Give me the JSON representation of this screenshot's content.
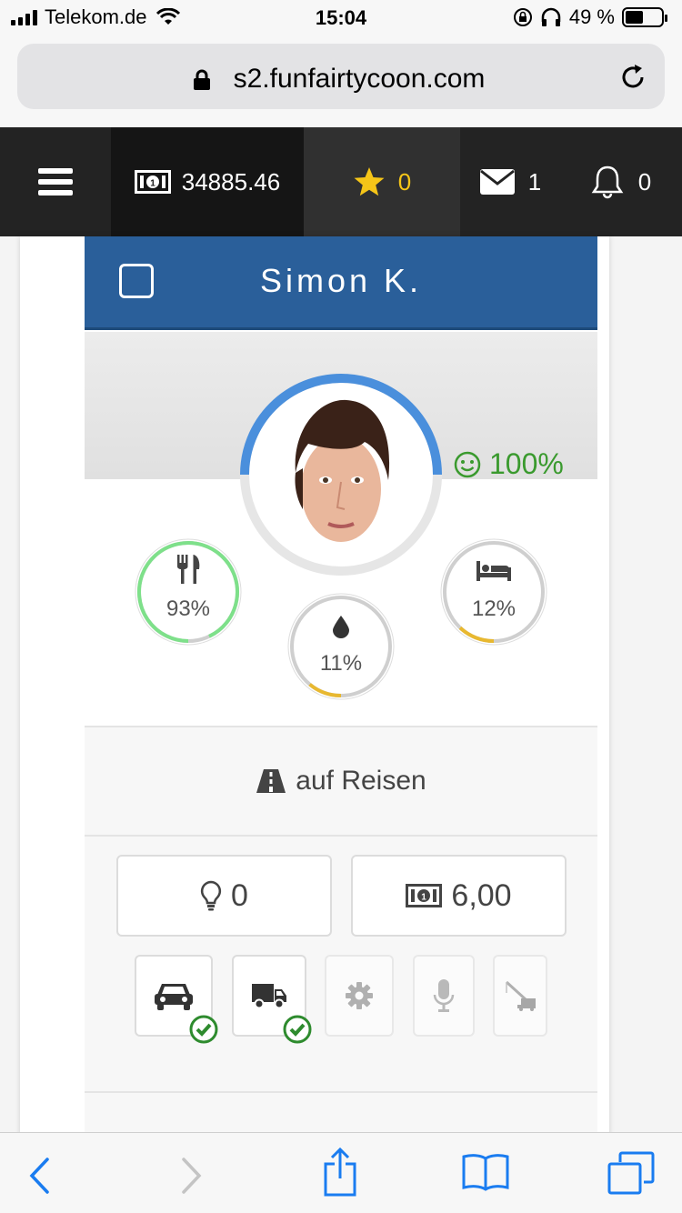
{
  "statusbar": {
    "carrier": "Telekom.de",
    "time": "15:04",
    "battery_percent": "49 %",
    "battery_level": 0.49
  },
  "browser": {
    "url": "s2.funfairtycoon.com"
  },
  "nav": {
    "money": "34885.46",
    "stars": "0",
    "messages": "1",
    "notifications": "0"
  },
  "character": {
    "name": "Simon K.",
    "happiness": "100%",
    "happiness_level": 1.0,
    "stats": [
      {
        "name": "food",
        "icon": "fork-knife-icon",
        "value": "93%",
        "level": 0.93,
        "color": "#7ee08a"
      },
      {
        "name": "drink",
        "icon": "droplet-icon",
        "value": "11%",
        "level": 0.11,
        "color": "#e8b830"
      },
      {
        "name": "sleep",
        "icon": "bed-icon",
        "value": "12%",
        "level": 0.12,
        "color": "#e8b830"
      }
    ],
    "status": "auf Reisen",
    "ideas": "0",
    "wage": "6,00",
    "skills": [
      {
        "name": "car",
        "icon": "car-icon",
        "active": true
      },
      {
        "name": "truck",
        "icon": "truck-icon",
        "active": true
      },
      {
        "name": "mechanic",
        "icon": "gear-icon",
        "active": false
      },
      {
        "name": "announcer",
        "icon": "microphone-icon",
        "active": false
      },
      {
        "name": "crane",
        "icon": "crane-icon",
        "active": false
      }
    ]
  },
  "colors": {
    "navbar": "#232323",
    "header_blue": "#2a5f9a",
    "happy_green": "#3a9a2e",
    "star_yellow": "#f5c518",
    "check_green": "#2e8b2e",
    "ios_blue": "#1a7cf0"
  }
}
